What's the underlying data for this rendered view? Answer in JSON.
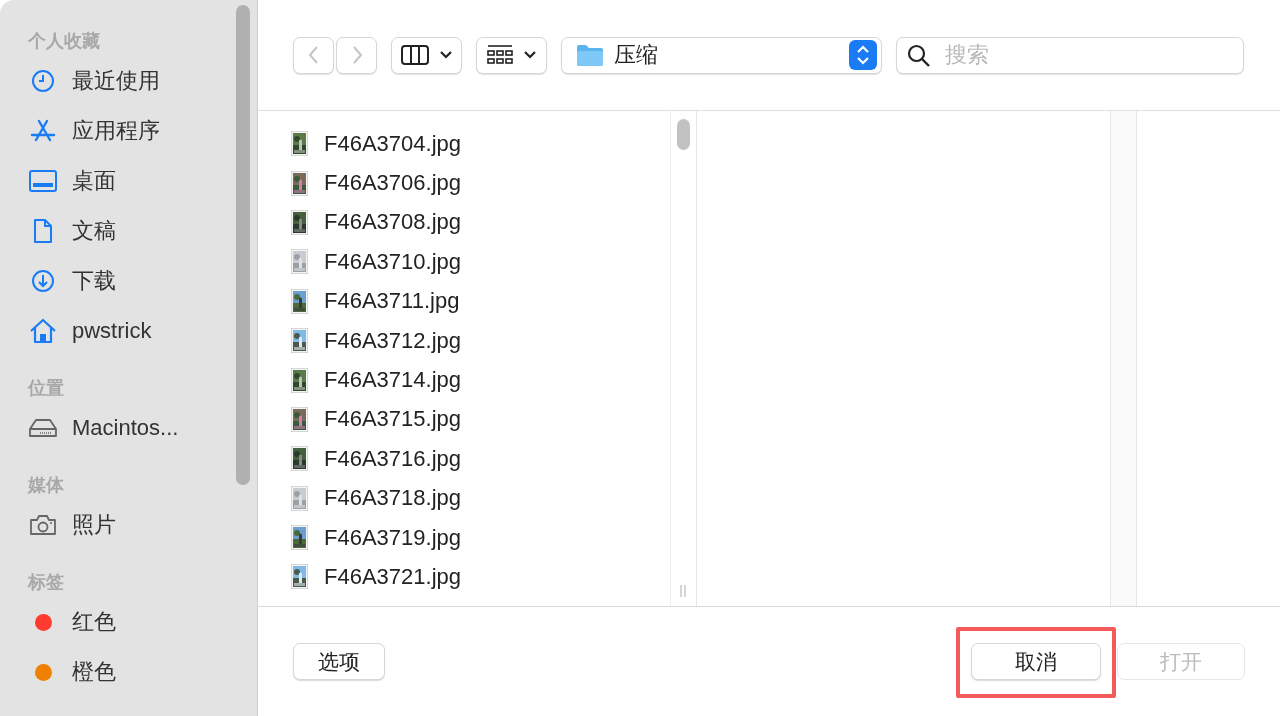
{
  "sidebar": {
    "sections": [
      {
        "heading": "个人收藏",
        "items": [
          {
            "label": "最近使用",
            "kind": "clock"
          },
          {
            "label": "应用程序",
            "kind": "apps"
          },
          {
            "label": "桌面",
            "kind": "desktop"
          },
          {
            "label": "文稿",
            "kind": "document"
          },
          {
            "label": "下载",
            "kind": "download"
          },
          {
            "label": "pwstrick",
            "kind": "home"
          }
        ]
      },
      {
        "heading": "位置",
        "items": [
          {
            "label": "Macintos...",
            "kind": "disk"
          }
        ]
      },
      {
        "heading": "媒体",
        "items": [
          {
            "label": "照片",
            "kind": "camera"
          }
        ]
      },
      {
        "heading": "标签",
        "items": [
          {
            "label": "红色",
            "kind": "tag",
            "color": "#ff3b30"
          },
          {
            "label": "橙色",
            "kind": "tag",
            "color": "#f08000"
          }
        ]
      }
    ]
  },
  "toolbar": {
    "nav": [
      {
        "kind": "back",
        "disabled": true
      },
      {
        "kind": "forward",
        "disabled": true
      }
    ],
    "path": {
      "label": "压缩"
    },
    "search": {
      "placeholder": "搜索"
    }
  },
  "files": [
    {
      "name": "F46A3704.jpg",
      "kind": "picture"
    },
    {
      "name": "F46A3706.jpg",
      "kind": "picture"
    },
    {
      "name": "F46A3708.jpg",
      "kind": "picture"
    },
    {
      "name": "F46A3710.jpg",
      "kind": "picture"
    },
    {
      "name": "F46A3711.jpg",
      "kind": "picture"
    },
    {
      "name": "F46A3712.jpg",
      "kind": "picture"
    },
    {
      "name": "F46A3714.jpg",
      "kind": "picture"
    },
    {
      "name": "F46A3715.jpg",
      "kind": "picture"
    },
    {
      "name": "F46A3716.jpg",
      "kind": "picture"
    },
    {
      "name": "F46A3718.jpg",
      "kind": "picture"
    },
    {
      "name": "F46A3719.jpg",
      "kind": "picture"
    },
    {
      "name": "F46A3721.jpg",
      "kind": "picture"
    }
  ],
  "footer": {
    "options": {
      "label": "选项"
    },
    "buttons": [
      {
        "label": "取消",
        "disabled": false,
        "highlighted": true
      },
      {
        "label": "打开",
        "disabled": true,
        "highlighted": false
      }
    ]
  }
}
